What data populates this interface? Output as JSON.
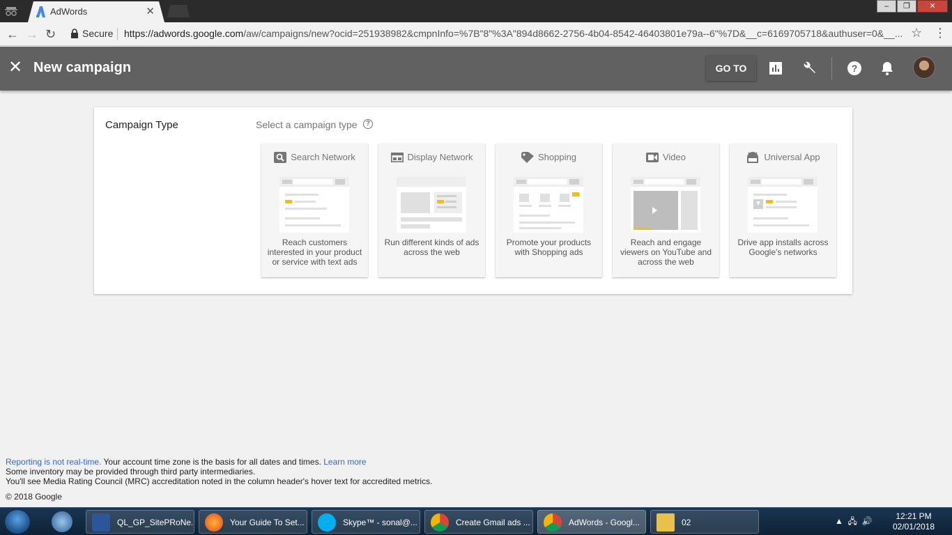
{
  "browser": {
    "tab_title": "AdWords",
    "secure_label": "Secure",
    "url_host": "https://adwords.google.com",
    "url_path": "/aw/campaigns/new?ocid=251938982&cmpnInfo=%7B\"8\"%3A\"894d8662-2756-4b04-8542-46403801e79a--6\"%7D&__c=6169705718&authuser=0&__..."
  },
  "header": {
    "title": "New campaign",
    "goto_label": "GO TO"
  },
  "card": {
    "label": "Campaign Type",
    "prompt": "Select a campaign type",
    "options": [
      {
        "title": "Search Network",
        "desc": "Reach customers interested in your product or service with text ads",
        "icon": "search-icon"
      },
      {
        "title": "Display Network",
        "desc": "Run different kinds of ads across the web",
        "icon": "display-icon"
      },
      {
        "title": "Shopping",
        "desc": "Promote your products with Shopping ads",
        "icon": "tag-icon"
      },
      {
        "title": "Video",
        "desc": "Reach and engage viewers on YouTube and across the web",
        "icon": "video-icon"
      },
      {
        "title": "Universal App",
        "desc": "Drive app installs across Google's networks",
        "icon": "android-icon"
      }
    ]
  },
  "footer": {
    "link1": "Reporting is not real-time.",
    "text1": " Your account time zone is the basis for all dates and times. ",
    "link2": "Learn more",
    "line2": "Some inventory may be provided through third party intermediaries.",
    "line3": "You'll see Media Rating Council (MRC) accreditation noted in the column header's hover text for accredited metrics.",
    "copyright": "© 2018 Google"
  },
  "taskbar": {
    "items": [
      {
        "label": "QL_GP_SitePRoNe..."
      },
      {
        "label": "Your Guide To Set..."
      },
      {
        "label": "Skype™ - sonal@..."
      },
      {
        "label": "Create Gmail ads ..."
      },
      {
        "label": "AdWords - Googl..."
      },
      {
        "label": "02"
      }
    ],
    "time": "12:21 PM",
    "date": "02/01/2018"
  },
  "colors": {
    "appbar": "#616161",
    "accent_yellow": "#fbbc05",
    "link_blue": "#3367d6"
  }
}
